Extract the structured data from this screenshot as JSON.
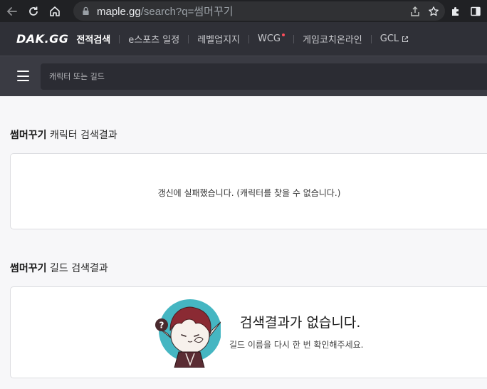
{
  "browser": {
    "url_host": "maple.gg",
    "url_path": "/search?q=썸머꾸기"
  },
  "nav": {
    "logo": "DAK.GG",
    "items": [
      {
        "label": "전적검색"
      },
      {
        "label": "e스포츠 일정"
      },
      {
        "label": "레벨업지지"
      },
      {
        "label": "WCG"
      },
      {
        "label": "게임코치온라인"
      },
      {
        "label": "GCL"
      }
    ],
    "accent_dot_color": "#ff4d5b"
  },
  "search": {
    "placeholder": "캐릭터 또는 길드"
  },
  "character_section": {
    "query": "썸머꾸기",
    "title_suffix": " 캐릭터 검색결과",
    "message": "갱신에 실패했습니다. (캐릭터를 찾을 수 없습니다.)"
  },
  "guild_section": {
    "query": "썸머꾸기",
    "title_suffix": " 길드 검색결과",
    "empty_title": "검색결과가 없습니다.",
    "empty_subtitle": "길드 이름을 다시 한 번 확인해주세요.",
    "mascot_bubble": "?"
  }
}
